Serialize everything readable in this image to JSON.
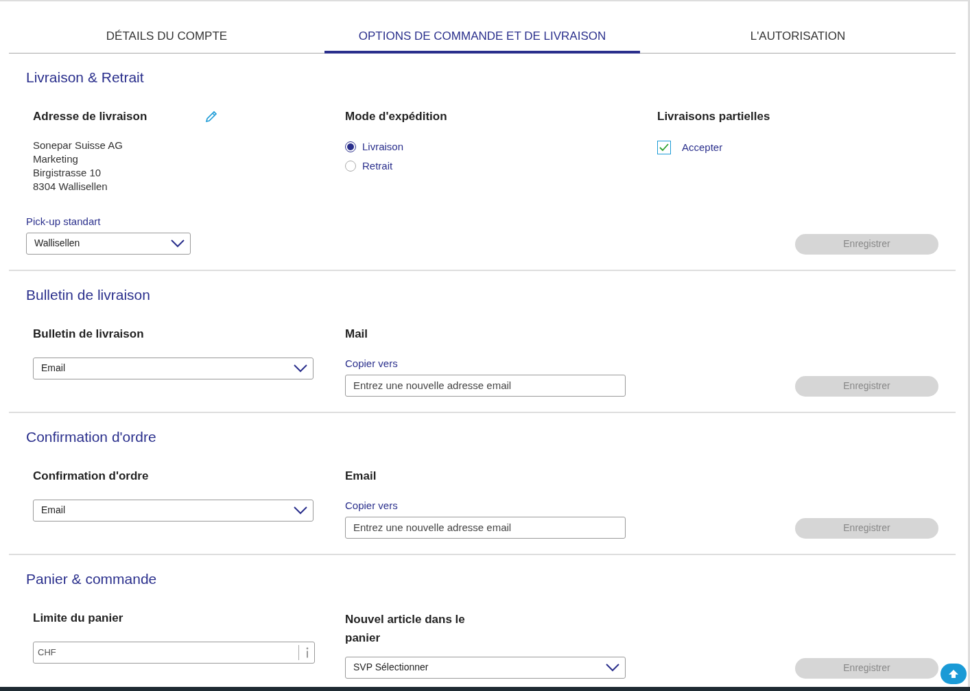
{
  "tabs": [
    {
      "label": "DÉTAILS DU COMPTE",
      "selected": false
    },
    {
      "label": "OPTIONS DE COMMANDE ET DE LIVRAISON",
      "selected": true
    },
    {
      "label": "L'AUTORISATION",
      "selected": false
    }
  ],
  "sections": [
    {
      "title": "Livraison & Retrait",
      "save_button": "Enregistrer",
      "columns": [
        [
          {
            "kind": "heading",
            "text": "Adresse de livraison",
            "editable": true
          },
          {
            "kind": "lines",
            "lines": [
              "Sonepar Suisse AG",
              "Marketing",
              "Birgistrasse 10",
              "8304 Wallisellen"
            ]
          },
          {
            "kind": "label",
            "text": "Pick-up standart",
            "compact": true
          },
          {
            "kind": "select",
            "value": "Wallisellen",
            "compact": true
          }
        ],
        [
          {
            "kind": "heading",
            "text": "Mode d'expédition"
          },
          {
            "kind": "radios",
            "options": [
              {
                "label": "Livraison",
                "selected": true
              },
              {
                "label": "Retrait",
                "selected": false
              }
            ]
          }
        ],
        [
          {
            "kind": "heading",
            "text": "Livraisons partielles"
          },
          {
            "kind": "checkbox",
            "label": "Accepter",
            "checked": true
          }
        ]
      ]
    },
    {
      "title": "Bulletin de livraison",
      "save_button": "Enregistrer",
      "columns": [
        [
          {
            "kind": "heading",
            "text": "Bulletin de livraison"
          },
          {
            "kind": "select",
            "value": "Email"
          }
        ],
        [
          {
            "kind": "heading",
            "text": "Mail"
          },
          {
            "kind": "label",
            "text": "Copier vers"
          },
          {
            "kind": "input",
            "placeholder": "Entrez une nouvelle adresse email"
          }
        ],
        []
      ]
    },
    {
      "title": "Confirmation d'ordre",
      "save_button": "Enregistrer",
      "columns": [
        [
          {
            "kind": "heading",
            "text": "Confirmation d'ordre"
          },
          {
            "kind": "select",
            "value": "Email"
          }
        ],
        [
          {
            "kind": "heading",
            "text": "Email"
          },
          {
            "kind": "label",
            "text": "Copier vers"
          },
          {
            "kind": "input",
            "placeholder": "Entrez une nouvelle adresse email"
          }
        ],
        []
      ]
    },
    {
      "title": "Panier & commande",
      "save_button": "Enregistrer",
      "columns": [
        [
          {
            "kind": "heading",
            "text": "Limite du panier"
          },
          {
            "kind": "currency",
            "placeholder": "CHF"
          }
        ],
        [
          {
            "kind": "heading",
            "text": "Nouvel article dans le panier",
            "narrow": true
          },
          {
            "kind": "select",
            "value": "SVP Sélectionner"
          }
        ],
        []
      ]
    }
  ]
}
